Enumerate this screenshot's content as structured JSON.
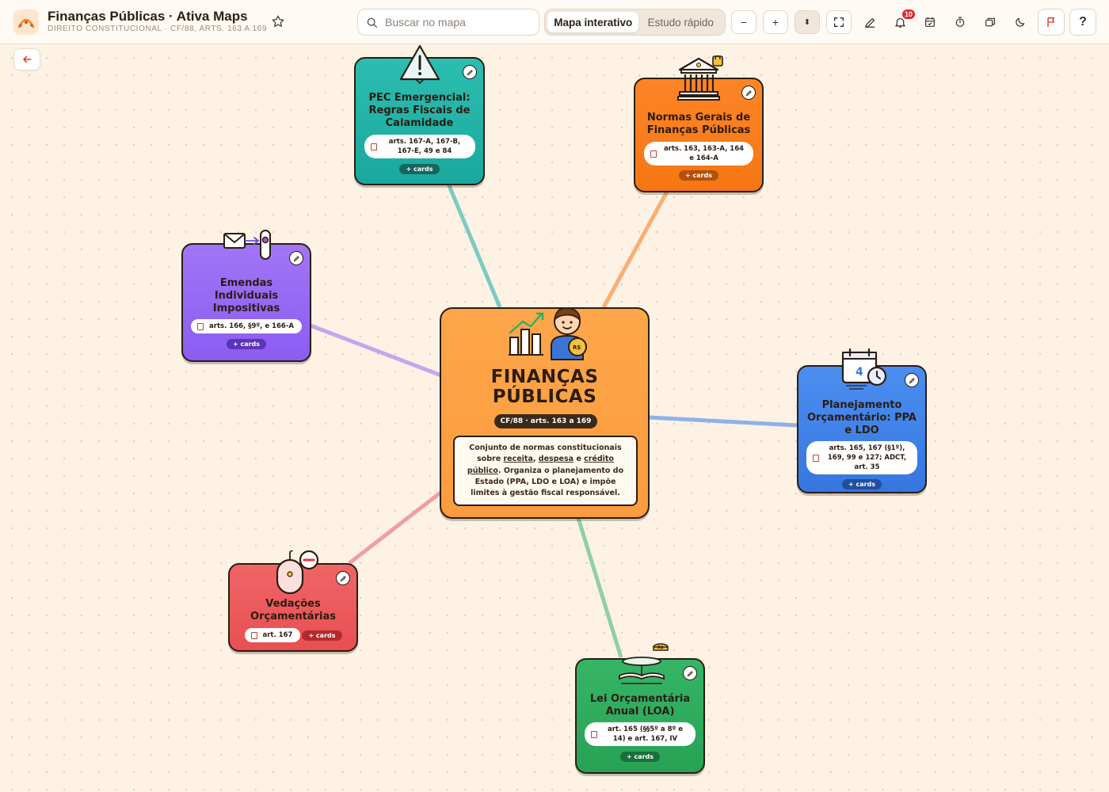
{
  "app": {
    "title": "Finanças Públicas · Ativa Maps",
    "subtitle": "DIREITO CONSTITUCIONAL · CF/88, ARTS. 163 A 169"
  },
  "search": {
    "placeholder": "Buscar no mapa",
    "value": ""
  },
  "view_toggle": {
    "active": "Mapa interativo",
    "inactive": "Estudo rápido"
  },
  "toolbar": {
    "zoom_out": "−",
    "zoom_in": "+",
    "zoom_fit": "⬍",
    "help": "?",
    "notifications_count": "10"
  },
  "colors": {
    "teal": "#22b3a8",
    "orange": "#fb7d18",
    "purple": "#9467f4",
    "blue": "#3f82e8",
    "red": "#ee5a5c",
    "green": "#2fae5e",
    "center": "#fda64a"
  },
  "center": {
    "title_line1": "FINANÇAS",
    "title_line2": "PÚBLICAS",
    "pill": "CF/88 · arts. 163 a 169",
    "desc_part1": "Conjunto de normas constitucionais sobre ",
    "desc_kw1": "receita",
    "desc_sep1": ", ",
    "desc_kw2": "despesa",
    "desc_sep2": " e ",
    "desc_kw3": "crédito público",
    "desc_part2": ". Organiza o planejamento do Estado (PPA, LDO e LOA) e impõe limites à gestão fiscal responsável.",
    "coin_label": "R$"
  },
  "nodes": {
    "pec": {
      "title": "PEC Emergencial: Regras Fiscais de Calamidade",
      "ref": "arts. 167-A, 167-B, 167-E, 49 e 84",
      "cards": "+ cards"
    },
    "normas": {
      "title": "Normas Gerais de Finanças Públicas",
      "ref": "arts. 163, 163-A, 164 e 164-A",
      "cards": "+ cards"
    },
    "emendas": {
      "title": "Emendas Individuais Impositivas",
      "ref": "arts. 166, §9º, e 166-A",
      "cards": "+ cards"
    },
    "ppa": {
      "title": "Planejamento Orçamentário: PPA e LDO",
      "ref": "arts. 165, 167 (§1º), 169, 99 e 127; ADCT, art. 35",
      "cards": "+ cards",
      "calendar_day": "4"
    },
    "vedacoes": {
      "title": "Vedações Orçamentárias",
      "ref": "art. 167",
      "cards": "+ cards"
    },
    "loa": {
      "title": "Lei Orçamentária Anual (LOA)",
      "ref": "art. 165 (§§5º a 8º e 14) e art. 167, IV",
      "cards": "+ cards",
      "coin_label": "R$"
    }
  }
}
